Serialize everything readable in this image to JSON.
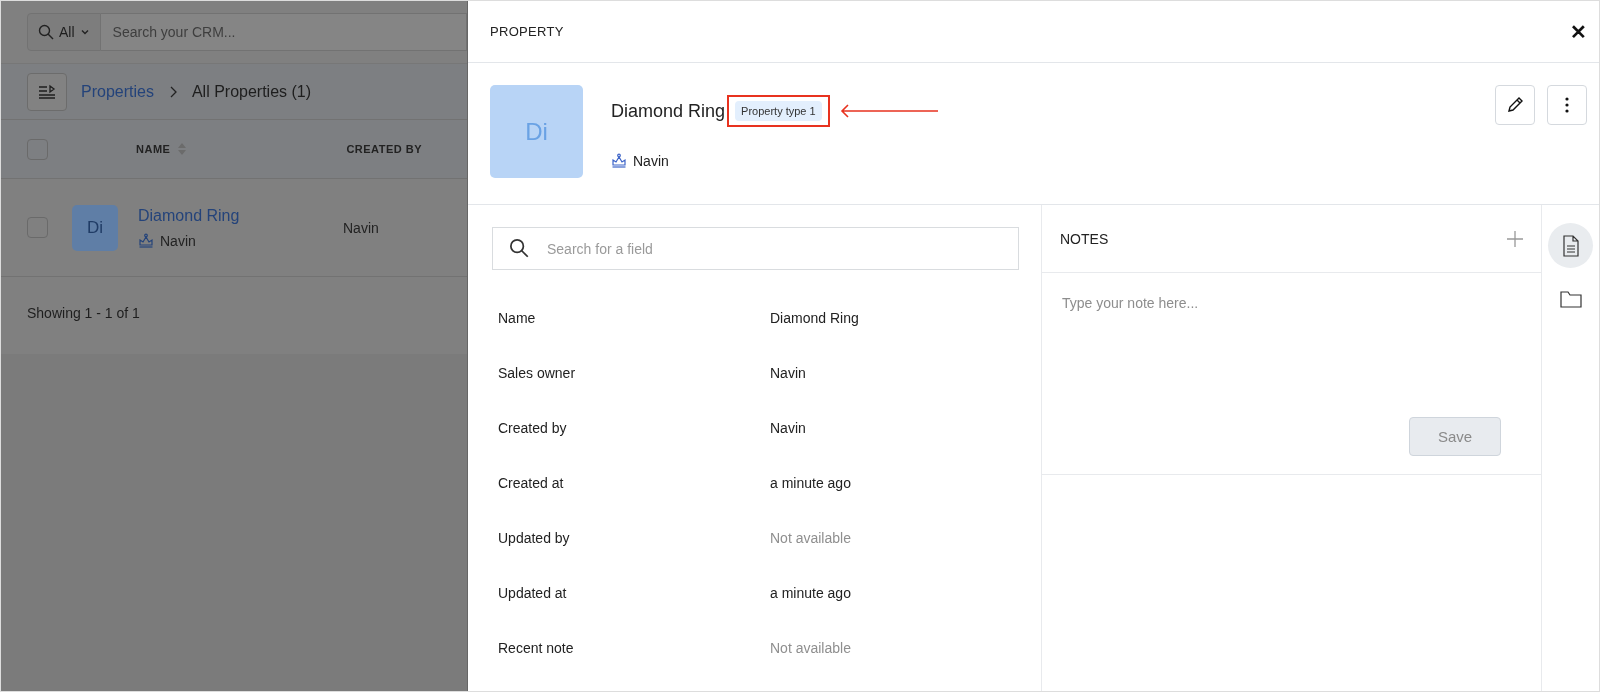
{
  "background_page": {
    "search": {
      "scope": "All",
      "placeholder": "Search your CRM..."
    },
    "breadcrumb": {
      "parent": "Properties",
      "current": "All Properties (1)"
    },
    "table": {
      "select_all_checked": false,
      "columns": [
        {
          "label": "NAME",
          "sortable": true
        },
        {
          "label": "CREATED BY",
          "sortable": false
        }
      ],
      "rows": [
        {
          "checked": false,
          "initials": "Di",
          "name": "Diamond Ring",
          "owner": "Navin",
          "created_by": "Navin"
        }
      ]
    },
    "footer": "Showing 1 - 1 of 1"
  },
  "drawer": {
    "title": "PROPERTY",
    "close": "✕",
    "record": {
      "initials": "Di",
      "name": "Diamond Ring",
      "badge": {
        "label": "Property type 1",
        "highlighted": true
      },
      "owner": "Navin"
    },
    "field_search": {
      "placeholder": "Search for a field"
    },
    "fields": [
      {
        "label": "Name",
        "value": "Diamond Ring",
        "empty": false
      },
      {
        "label": "Sales owner",
        "value": "Navin",
        "empty": false
      },
      {
        "label": "Created by",
        "value": "Navin",
        "empty": false
      },
      {
        "label": "Created at",
        "value": "a minute ago",
        "empty": false
      },
      {
        "label": "Updated by",
        "value": "Not available",
        "empty": true
      },
      {
        "label": "Updated at",
        "value": "a minute ago",
        "empty": false
      },
      {
        "label": "Recent note",
        "value": "Not available",
        "empty": true
      }
    ],
    "notes": {
      "title": "NOTES",
      "placeholder": "Type your note here...",
      "save": "Save",
      "save_disabled": true
    },
    "rail": [
      {
        "kind": "notes",
        "selected": true
      },
      {
        "kind": "files",
        "selected": false
      }
    ]
  }
}
